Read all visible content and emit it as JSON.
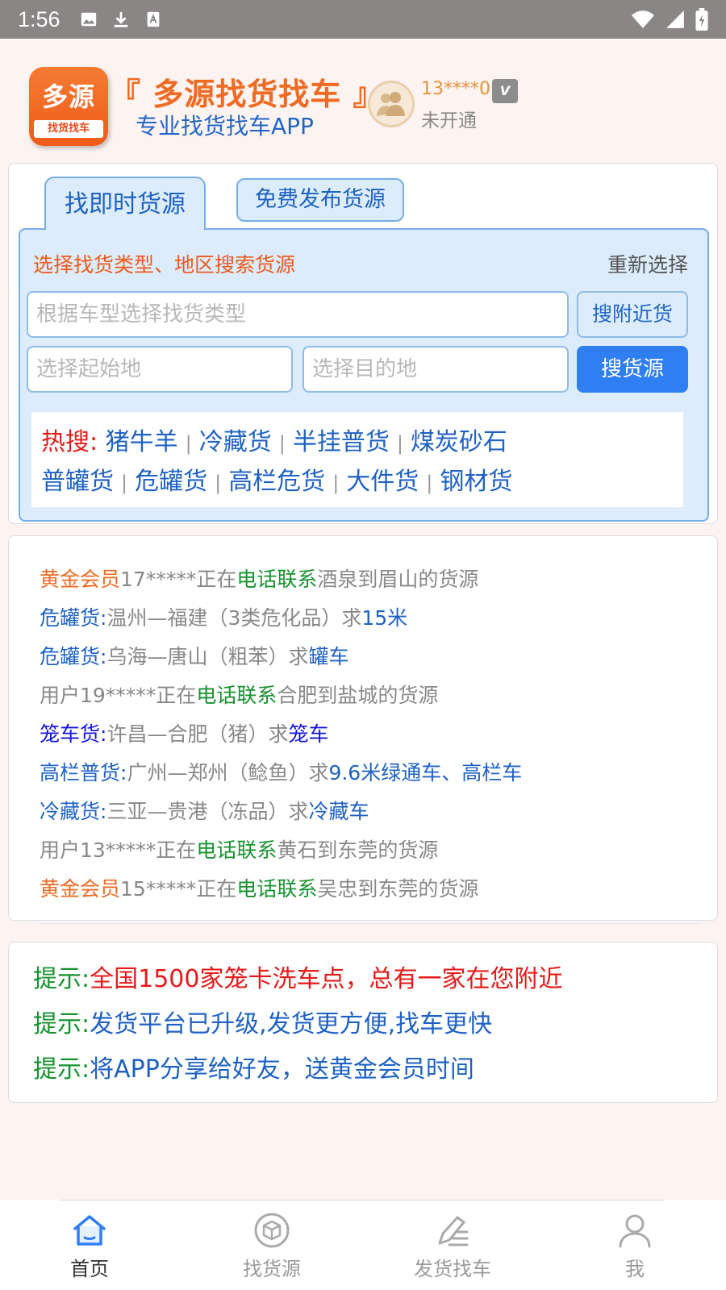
{
  "status_bar": {
    "time": "1:56"
  },
  "header": {
    "logo_main": "多源",
    "logo_sub": "找货找车",
    "app_title": "『 多源找货找车 』",
    "app_subtitle": "专业找货找车APP",
    "user_id": "13****0",
    "vip_badge": "V",
    "member_status": "未开通"
  },
  "search": {
    "tab_active": "找即时货源",
    "tab_publish": "免费发布货源",
    "hint": "选择找货类型、地区搜索货源",
    "reselect": "重新选择",
    "type_placeholder": "根据车型选择找货类型",
    "nearby_button": "搜附近货",
    "from_placeholder": "选择起始地",
    "to_placeholder": "选择目的地",
    "search_button": "搜货源",
    "hot_label": "热搜:",
    "hot_row1": [
      "猪牛羊",
      "冷藏货",
      "半挂普货",
      "煤炭砂石"
    ],
    "hot_row2": [
      "普罐货",
      "危罐货",
      "高栏危货",
      "大件货",
      "钢材货"
    ]
  },
  "feed": [
    {
      "a": "黄金会员",
      "b": "17*****正在",
      "c": "电话联系",
      "d": "酒泉到眉山的货源"
    },
    {
      "a": "危罐货:",
      "b": "温州—福建（3类危化品）求",
      "c": "15米",
      "d": ""
    },
    {
      "a": "危罐货:",
      "b": "乌海—唐山（粗苯）求",
      "c": "罐车",
      "d": ""
    },
    {
      "a": "",
      "b": "用户19*****正在",
      "c": "电话联系",
      "d": "合肥到盐城的货源"
    },
    {
      "a": "笼车货:",
      "b": "许昌—合肥（猪）求",
      "c": "笼车",
      "d": ""
    },
    {
      "a": "高栏普货:",
      "b": "广州—郑州（鲶鱼）求",
      "c": "9.6米绿通车、高栏车",
      "d": ""
    },
    {
      "a": "冷藏货:",
      "b": "三亚—贵港（冻品）求",
      "c": "冷藏车",
      "d": ""
    },
    {
      "a": "",
      "b": "用户13*****正在",
      "c": "电话联系",
      "d": "黄石到东莞的货源"
    },
    {
      "a": "黄金会员",
      "b": "15*****正在",
      "c": "电话联系",
      "d": "吴忠到东莞的货源"
    }
  ],
  "tips": [
    {
      "prefix": "提示:",
      "text": "全国1500家笼卡洗车点，总有一家在您附近"
    },
    {
      "prefix": "提示:",
      "text": "发货平台已升级,发货更方便,找车更快"
    },
    {
      "prefix": "提示:",
      "text": "将APP分享给好友，送黄金会员时间"
    }
  ],
  "nav": [
    {
      "label": "首页",
      "icon": "home-icon"
    },
    {
      "label": "找货源",
      "icon": "box-icon"
    },
    {
      "label": "发货找车",
      "icon": "edit-icon"
    },
    {
      "label": "我",
      "icon": "user-icon"
    }
  ],
  "colors": {
    "primary_blue": "#2f7ff2",
    "accent_orange": "#ef6a22",
    "contact_green": "#17922f",
    "alert_red": "#e61a1a"
  }
}
